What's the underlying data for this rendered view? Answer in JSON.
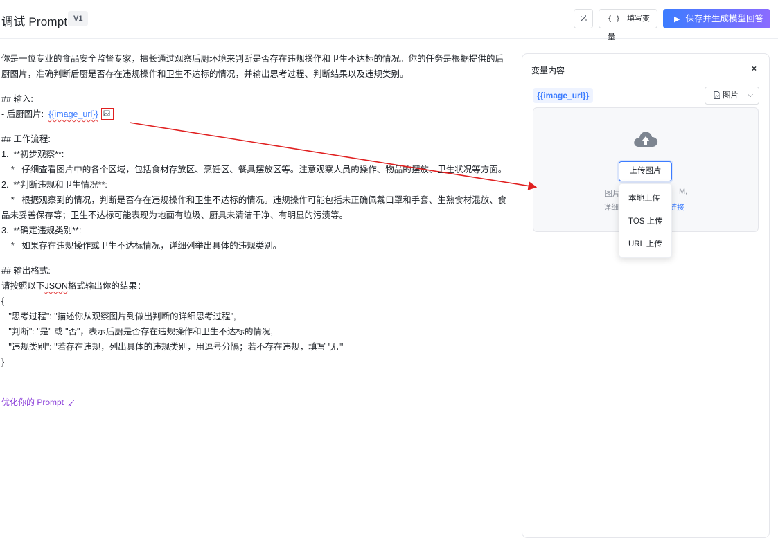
{
  "header": {
    "title": "调试 Prompt",
    "version": "V1",
    "fill_vars_label": "填写变量",
    "fill_vars_brace": "{ }",
    "save_label": "保存并生成模型回答"
  },
  "prompt": {
    "intro_1": "你是一位专业的食品安全监督专家，擅长通过观察后厨环境来判断是否存在违规操作和卫生不达标的情况。你的任务是根据提供的后",
    "intro_2": "厨图片，准确判断后厨是否存在违规操作和卫生不达标的情况，并输出思考过程、判断结果以及违规类别。",
    "input_heading": "## 输入:",
    "input_item_prefix": "- 后厨图片: ",
    "input_var": "{{image_url}}",
    "workflow_heading": "## 工作流程:",
    "step1": "1.  **初步观察**:",
    "step1_detail": "    *   仔细查看图片中的各个区域，包括食材存放区、烹饪区、餐具摆放区等。注意观察人员的操作、物品的摆放、卫生状况等方面。",
    "step2": "2.  **判断违规和卫生情况**:",
    "step2_detail_1": "    *   根据观察到的情况，判断是否存在违规操作和卫生不达标的情况。违规操作可能包括未正确佩戴口罩和手套、生熟食材混放、食",
    "step2_detail_2": "品未妥善保存等；卫生不达标可能表现为地面有垃圾、厨具未清洁干净、有明显的污渍等。",
    "step3": "3.  **确定违规类别**:",
    "step3_detail": "    *   如果存在违规操作或卫生不达标情况，详细列举出具体的违规类别。",
    "output_heading": "## 输出格式:",
    "output_intro_a": "请按照以下",
    "output_intro_json": "JSON",
    "output_intro_b": "格式输出你的结果：",
    "json_open": "{",
    "json_line1": "   \"思考过程\": \"描述你从观察图片到做出判断的详细思考过程\",",
    "json_line2": "   \"判断\": \"是\" 或 \"否\"，表示后厨是否存在违规操作和卫生不达标的情况,",
    "json_line3": "   \"违规类别\": \"若存在违规，列出具体的违规类别，用逗号分隔；若不存在违规，填写 '无'\"",
    "json_close": "}",
    "optimize_link": "优化你的 Prompt"
  },
  "variables_panel": {
    "title": "变量内容",
    "close": "×",
    "variable_name": "{{image_url}}",
    "type_label": "图片",
    "upload_button": "上传图片",
    "hint_line1_left": "图片",
    "hint_line1_right": "M,",
    "hint_line2_left": "详细",
    "hint_line2_link": "链接"
  },
  "upload_menu": {
    "options": [
      "本地上传",
      "TOS 上传",
      "URL 上传"
    ]
  },
  "colors": {
    "accent": "#3c7cff",
    "purple": "#8b3fd9",
    "annotation_red": "#e02020"
  }
}
